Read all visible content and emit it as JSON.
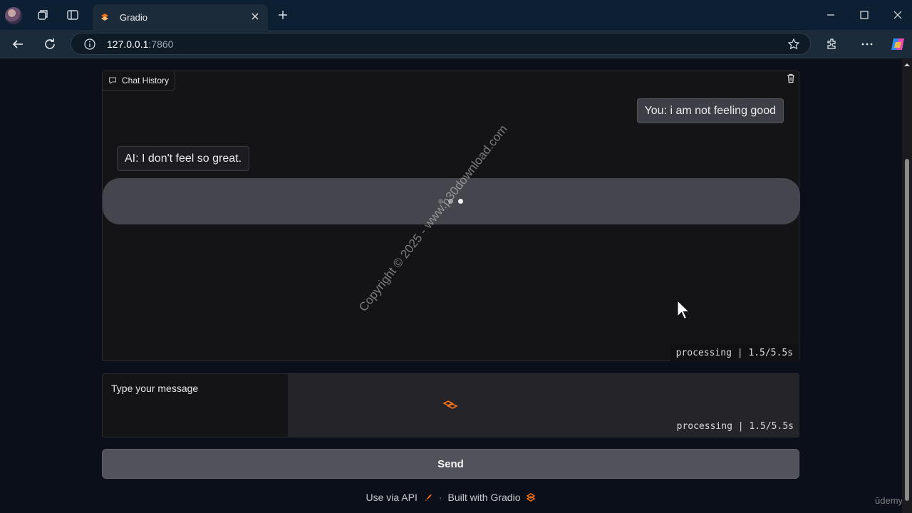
{
  "browser": {
    "tab_title": "Gradio",
    "url_host": "127.0.0.1",
    "url_port": ":7860",
    "icons": [
      "profile-avatar",
      "collections-icon",
      "tab-actions-icon",
      "close-icon",
      "plus-icon",
      "back-icon",
      "refresh-icon",
      "info-icon",
      "star-icon",
      "extensions-icon",
      "more-icon",
      "copilot-icon",
      "minimize-icon",
      "maximize-icon",
      "window-close-icon"
    ]
  },
  "chat": {
    "label": "Chat History",
    "messages": [
      {
        "role": "user",
        "text": "You: i am not feeling good"
      },
      {
        "role": "bot",
        "text": "AI: I don't feel so great."
      }
    ],
    "status": "processing | 1.5/5.5s"
  },
  "input": {
    "label": "Type your message",
    "status": "processing | 1.5/5.5s"
  },
  "send_button": {
    "label": "Send"
  },
  "footer": {
    "api_link": "Use via API",
    "separator": "·",
    "built_with": "Built with Gradio"
  },
  "watermark": "Copyright © 2025 - www.p30download.com",
  "overlay_brand": "ūdemy",
  "colors": {
    "accent_orange": "#f97316",
    "page_bg": "#0b0f19",
    "button_bg": "#52525b"
  }
}
